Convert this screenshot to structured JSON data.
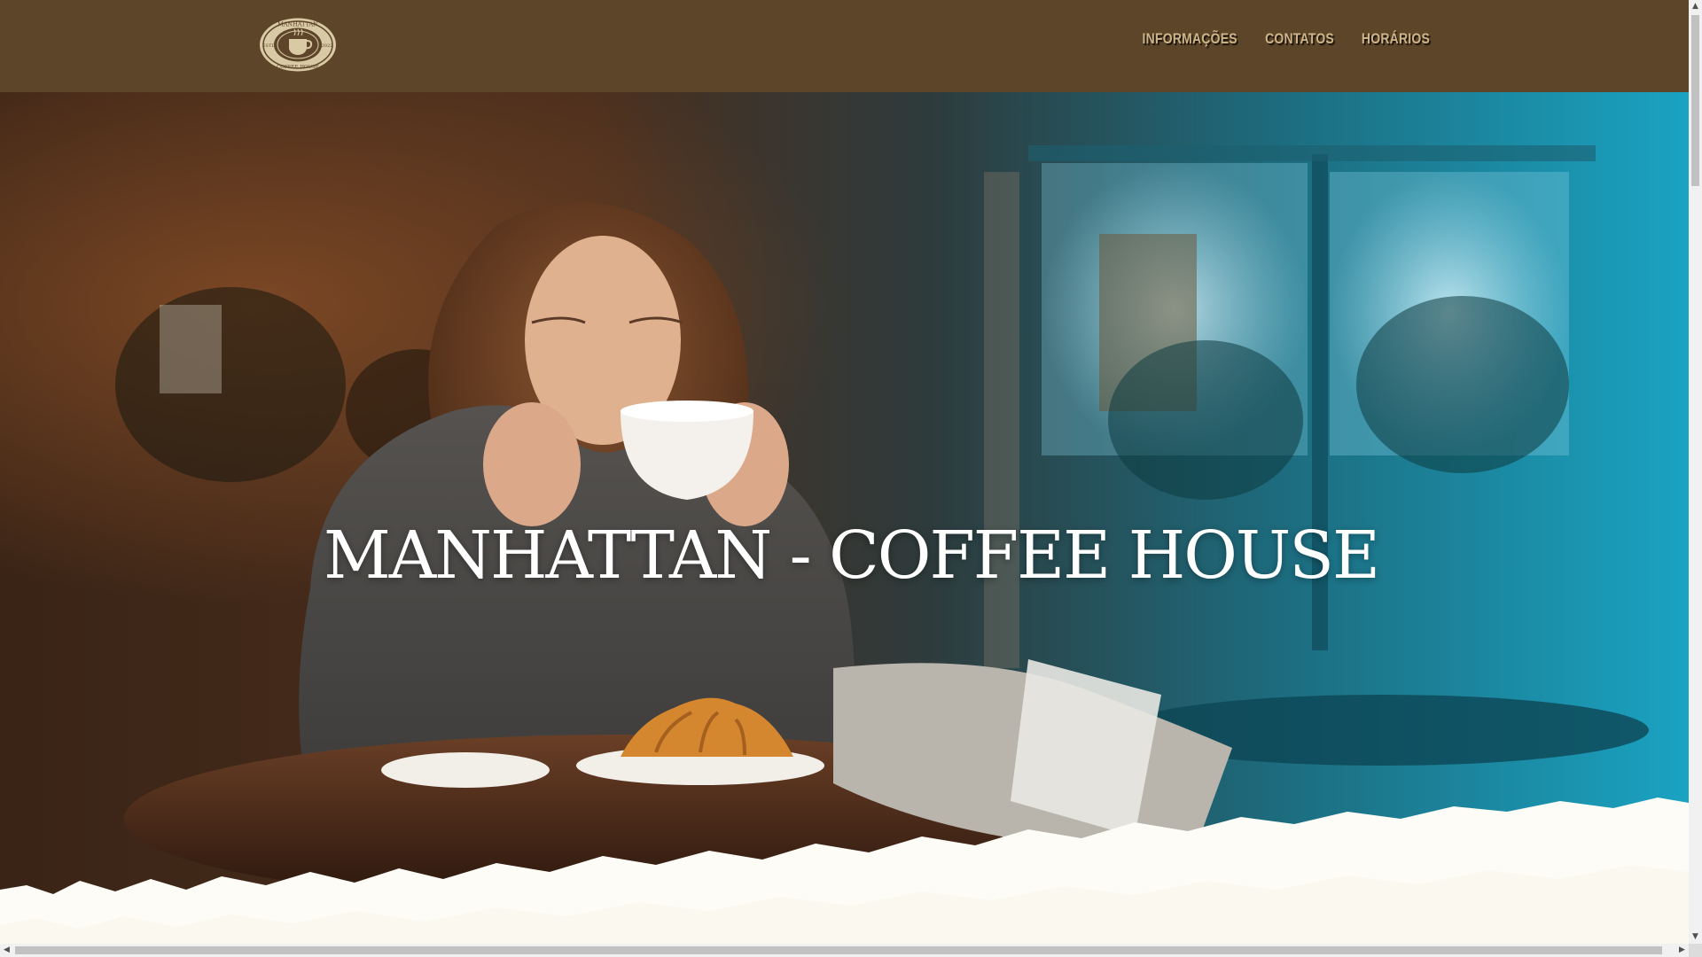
{
  "header": {
    "logo": {
      "name": "manhattan-coffee-house-logo",
      "top_text": "MANHATTAN",
      "bottom_text": "COFFEE HOUSE",
      "left_text": "ESTD",
      "right_text": "2022"
    },
    "nav": [
      {
        "label": "INFORMAÇÕES"
      },
      {
        "label": "CONTATOS"
      },
      {
        "label": "HORÁRIOS"
      }
    ]
  },
  "hero": {
    "title": "MANHATTAN - COFFEE HOUSE"
  },
  "colors": {
    "header_bg": "#5d4529",
    "nav_text": "#cdb489",
    "hero_title": "#ffffff",
    "torn_edge": "#fdfcf6"
  },
  "scrollbars": {
    "up_icon": "triangle-up",
    "down_icon": "triangle-down",
    "left_icon": "triangle-left",
    "right_icon": "triangle-right"
  }
}
